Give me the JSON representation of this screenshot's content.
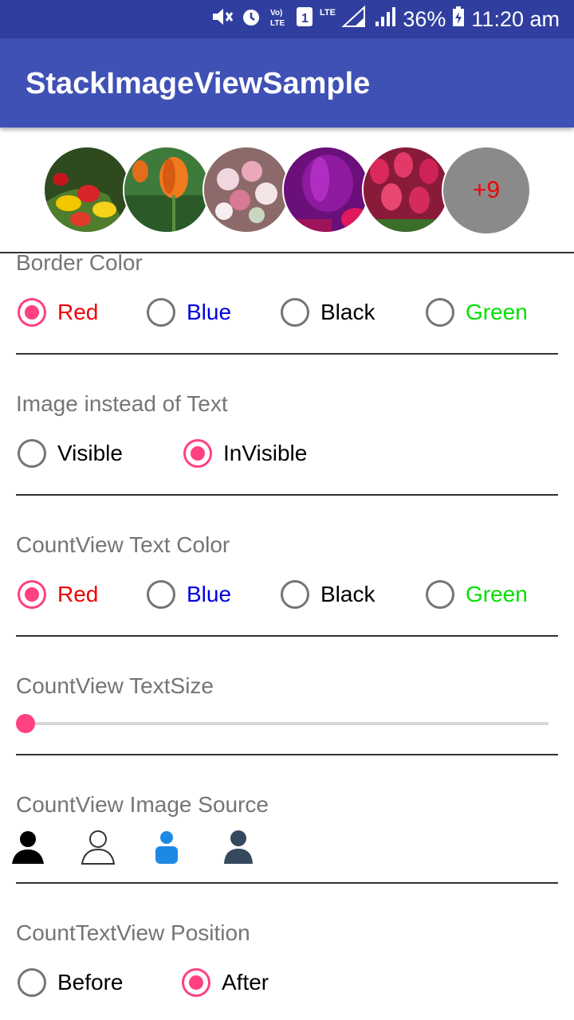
{
  "status": {
    "battery": "36%",
    "time": "11:20 am"
  },
  "app_title": "StackImageViewSample",
  "stack": {
    "count_text": "+9"
  },
  "border_color": {
    "title": "Border Color",
    "options": [
      {
        "label": "Red",
        "color": "#f00000",
        "checked": true
      },
      {
        "label": "Blue",
        "color": "#0000e0",
        "checked": false
      },
      {
        "label": "Black",
        "color": "#000000",
        "checked": false
      },
      {
        "label": "Green",
        "color": "#00e000",
        "checked": false
      }
    ]
  },
  "image_instead": {
    "title": "Image instead of Text",
    "options": [
      {
        "label": "Visible",
        "checked": false
      },
      {
        "label": "InVisible",
        "checked": true
      }
    ]
  },
  "count_text_color": {
    "title": "CountView Text Color",
    "options": [
      {
        "label": "Red",
        "color": "#f00000",
        "checked": true
      },
      {
        "label": "Blue",
        "color": "#0000e0",
        "checked": false
      },
      {
        "label": "Black",
        "color": "#000000",
        "checked": false
      },
      {
        "label": "Green",
        "color": "#00e000",
        "checked": false
      }
    ]
  },
  "text_size": {
    "title": "CountView TextSize",
    "value": 0
  },
  "image_source": {
    "title": "CountView Image Source",
    "icons": [
      "person-black-icon",
      "person-outline-icon",
      "person-blue-icon",
      "person-dark-icon"
    ]
  },
  "position": {
    "title": "CountTextView Position",
    "options": [
      {
        "label": "Before",
        "checked": false
      },
      {
        "label": "After",
        "checked": true
      }
    ]
  }
}
